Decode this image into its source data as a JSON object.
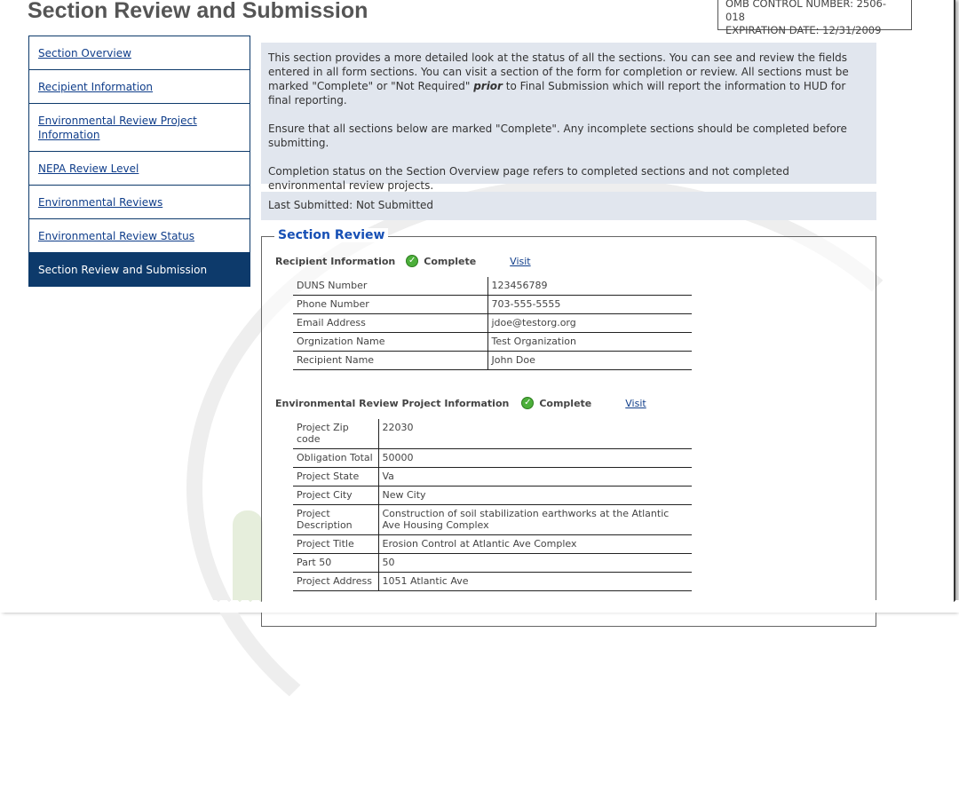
{
  "page_title": "Section Review and Submission",
  "omb": {
    "control_number": "OMB CONTROL NUMBER: 2506-018",
    "expiration": "EXPIRATION DATE: 12/31/2009"
  },
  "sidebar": {
    "items": [
      {
        "label": "Section Overview"
      },
      {
        "label": "Recipient Information"
      },
      {
        "label": "Environmental Review Project Information"
      },
      {
        "label": "NEPA Review Level"
      },
      {
        "label": "Environmental Reviews"
      },
      {
        "label": "Environmental Review Status"
      },
      {
        "label": "Section Review and Submission"
      }
    ]
  },
  "info": {
    "p1_before": "This section provides a more detailed look at the status of all the sections. You can see and review the fields entered in all form sections. You can visit a section of the form for completion or review. All sections must be marked \"Complete\" or \"Not Required\" ",
    "p1_emph": "prior",
    "p1_after": " to Final Submission which will report the information to HUD for final reporting.",
    "p2": "Ensure that all sections below are marked \"Complete\". Any incomplete sections should be completed before submitting.",
    "p3": "Completion status on the Section Overview page refers to completed sections and not completed environmental review projects."
  },
  "last_submitted": "Last Submitted: Not Submitted",
  "review": {
    "legend": "Section Review",
    "sections": [
      {
        "title": "Recipient Information",
        "status": "Complete",
        "visit": "Visit",
        "rows": [
          {
            "label": "DUNS Number",
            "value": "123456789"
          },
          {
            "label": "Phone Number",
            "value": "703-555-5555"
          },
          {
            "label": "Email Address",
            "value": "jdoe@testorg.org"
          },
          {
            "label": "Orgnization Name",
            "value": "Test Organization"
          },
          {
            "label": "Recipient Name",
            "value": "John Doe"
          }
        ]
      },
      {
        "title": "Environmental Review Project Information",
        "status": "Complete",
        "visit": "Visit",
        "rows": [
          {
            "label": "Project Zip code",
            "value": "22030"
          },
          {
            "label": "Obligation Total",
            "value": "50000"
          },
          {
            "label": "Project State",
            "value": "Va"
          },
          {
            "label": "Project City",
            "value": "New City"
          },
          {
            "label": "Project Description",
            "value": "Construction of soil stabilization earthworks at the Atlantic Ave Housing Complex"
          },
          {
            "label": "Project Title",
            "value": "Erosion Control at Atlantic Ave Complex"
          },
          {
            "label": "Part 50",
            "value": "50"
          },
          {
            "label": "Project Address",
            "value": "1051 Atlantic Ave"
          }
        ]
      }
    ]
  },
  "colors": {
    "nav_active_bg": "#0d3a6b",
    "info_bg": "#e1e6ee",
    "legend": "#1750b5",
    "check_green": "#4caf3a"
  }
}
